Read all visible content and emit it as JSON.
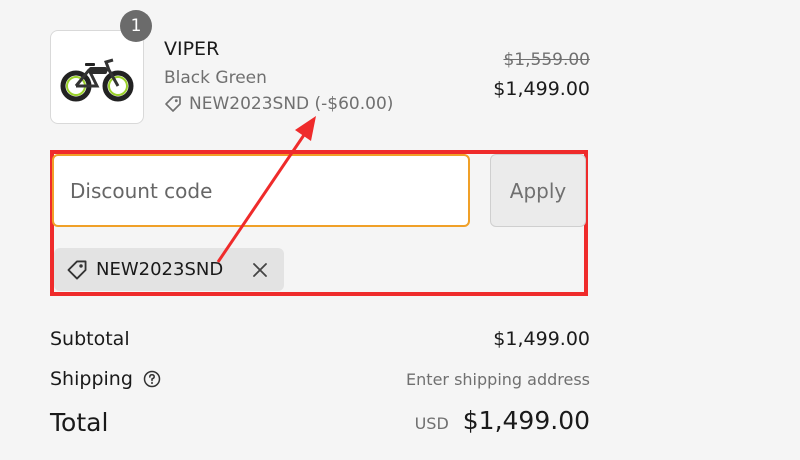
{
  "product": {
    "quantity": "1",
    "name": "VIPER",
    "variant": "Black Green",
    "discount_line": "NEW2023SND (-$60.00)",
    "price_original": "$1,559.00",
    "price_final": "$1,499.00",
    "image_icon": "e-bike-icon"
  },
  "discount": {
    "placeholder": "Discount code",
    "apply_label": "Apply",
    "applied_code": "NEW2023SND"
  },
  "summary": {
    "subtotal_label": "Subtotal",
    "subtotal_value": "$1,499.00",
    "shipping_label": "Shipping",
    "shipping_value": "Enter shipping address",
    "total_label": "Total",
    "currency": "USD",
    "total_value": "$1,499.00"
  },
  "colors": {
    "annotation_red": "#ef2b2b",
    "input_focus": "#f0a028"
  }
}
